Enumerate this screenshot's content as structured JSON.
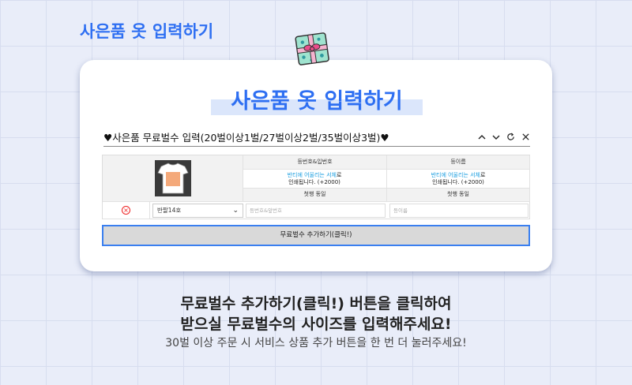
{
  "page": {
    "top_title": "사은품 옷 입력하기"
  },
  "card": {
    "title": "사은품 옷 입력하기",
    "form_label": "♥사은품 무료벌수 입력(20벌이상1벌/27벌이상2벌/35벌이상3벌)♥",
    "headers": {
      "col1": "등번호&입번호",
      "col2": "등이름",
      "col1_sub": "첫행 동일",
      "col2_sub": "첫행 동일"
    },
    "notice": {
      "line1_em": "반티에 어울리는 서체",
      "line1_rest": "로",
      "line2": "인쇄됩니다. (+2000)"
    },
    "row": {
      "size_selected": "반팔14호",
      "number_placeholder": "등번호&앞번호",
      "name_placeholder": "등이름"
    },
    "add_button": "무료벌수 추가하기(클릭!)"
  },
  "instructions": {
    "line1": "무료벌수 추가하기(클릭!) 버튼을 클릭하여",
    "line2": "받으실 무료벌수의 사이즈를 입력해주세요!",
    "line3": "30벌 이상 주문 시 서비스 상품 추가 버튼을 한 번 더 눌러주세요!"
  },
  "colors": {
    "accent": "#2e6ff2",
    "highlight": "#dbe6fb",
    "delete": "#e22222"
  }
}
